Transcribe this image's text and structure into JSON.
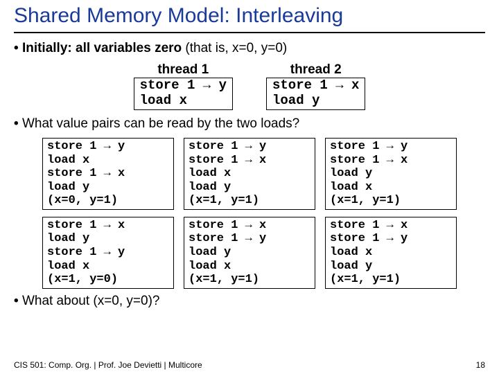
{
  "title": "Shared Memory Model: Interleaving",
  "bullet1_bold": "Initially: all variables zero",
  "bullet1_rest": " (that is, x=0, y=0)",
  "thread1": {
    "header": "thread 1",
    "code": "store 1 → y\nload x"
  },
  "thread2": {
    "header": "thread 2",
    "code": "store 1 → x\nload y"
  },
  "bullet2": "What value pairs can be read by the two loads?",
  "interleavings": [
    "store 1 → y\nload x\nstore 1 → x\nload y\n(x=0, y=1)",
    "store 1 → y\nstore 1 → x\nload x\nload y\n(x=1, y=1)",
    "store 1 → y\nstore 1 → x\nload y\nload x\n(x=1, y=1)",
    "store 1 → x\nload y\nstore 1 → y\nload x\n(x=1, y=0)",
    "store 1 → x\nstore 1 → y\nload y\nload x\n(x=1, y=1)",
    "store 1 → x\nstore 1 → y\nload x\nload y\n(x=1, y=1)"
  ],
  "bullet3": "What about (x=0, y=0)?",
  "footer_left": "CIS 501: Comp. Org.  |  Prof. Joe Devietti  |  Multicore",
  "footer_right": "18"
}
